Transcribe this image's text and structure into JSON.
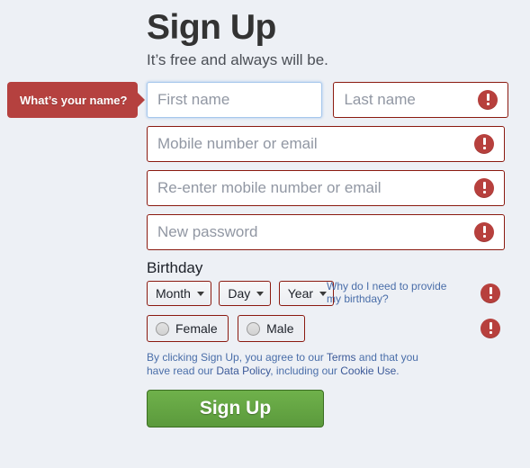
{
  "page": {
    "title": "Sign Up",
    "subtitle": "It’s free and always will be.",
    "background_color": "#edf0f5"
  },
  "tooltip": {
    "text": "What’s your name?",
    "color": "#b5413f"
  },
  "fields": {
    "first_name": {
      "placeholder": "First name",
      "state": "focused"
    },
    "last_name": {
      "placeholder": "Last name",
      "state": "error"
    },
    "mobile_or_email": {
      "placeholder": "Mobile number or email",
      "state": "error"
    },
    "reenter_mobile_or_email": {
      "placeholder": "Re-enter mobile number or email",
      "state": "error"
    },
    "new_password": {
      "placeholder": "New password",
      "state": "error"
    }
  },
  "birthday": {
    "label": "Birthday",
    "month": "Month",
    "day": "Day",
    "year": "Year",
    "help_link": "Why do I need to provide my birthday?"
  },
  "gender": {
    "female": "Female",
    "male": "Male"
  },
  "legal": {
    "part1": "By clicking Sign Up, you agree to our ",
    "terms": "Terms",
    "part2": " and that you have read our ",
    "data_policy": "Data Policy",
    "part3": ", including our ",
    "cookie_use": "Cookie Use",
    "part4": "."
  },
  "submit": {
    "label": "Sign Up",
    "color": "#5b9a3c"
  },
  "error_icon": {
    "name": "error-exclamation-icon",
    "color": "#b7403d"
  }
}
